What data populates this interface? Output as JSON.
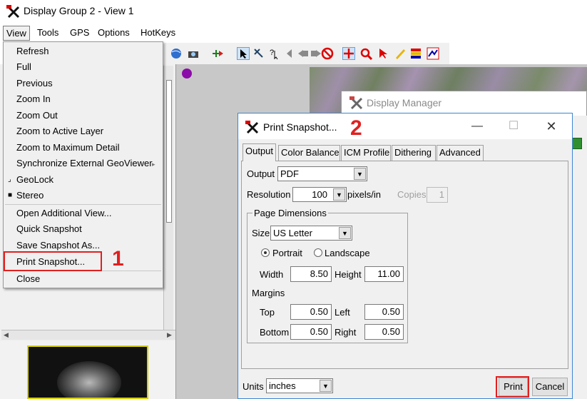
{
  "main_window": {
    "title": "Display Group 2 - View 1",
    "menu": [
      "View",
      "Tools",
      "GPS",
      "Options",
      "HotKeys"
    ]
  },
  "view_menu": {
    "items": [
      {
        "label": "Refresh"
      },
      {
        "label": "Full"
      },
      {
        "label": "Previous"
      },
      {
        "label": "Zoom In"
      },
      {
        "label": "Zoom Out"
      },
      {
        "label": "Zoom to Active Layer"
      },
      {
        "label": "Zoom to Maximum Detail"
      },
      {
        "label": "Synchronize External GeoViewer",
        "submenu": true
      },
      {
        "label": "GeoLock",
        "check": "unchecked"
      },
      {
        "label": "Stereo",
        "check": "checked"
      },
      {
        "label": "Open Additional View..."
      },
      {
        "label": "Quick Snapshot"
      },
      {
        "label": "Save Snapshot As..."
      },
      {
        "label": "Print Snapshot..."
      },
      {
        "label": "Close"
      }
    ]
  },
  "annotations": {
    "step1": "1",
    "step2": "2",
    "highlight_color": "#e02020"
  },
  "display_manager": {
    "title": "Display Manager"
  },
  "print_dialog": {
    "title": "Print Snapshot...",
    "tabs": [
      "Output",
      "Color Balance",
      "ICM Profile",
      "Dithering",
      "Advanced"
    ],
    "output_label": "Output",
    "output_value": "PDF",
    "resolution_label": "Resolution",
    "resolution_value": "100",
    "resolution_units": "pixels/in",
    "copies_label": "Copies",
    "copies_value": "1",
    "page_dimensions": {
      "title": "Page Dimensions",
      "size_label": "Size",
      "size_value": "US Letter",
      "orientation_portrait": "Portrait",
      "orientation_landscape": "Landscape",
      "selected_orientation": "Portrait",
      "width_label": "Width",
      "width_value": "8.50",
      "height_label": "Height",
      "height_value": "11.00",
      "margins_label": "Margins",
      "top_label": "Top",
      "top_value": "0.50",
      "left_label": "Left",
      "left_value": "0.50",
      "bottom_label": "Bottom",
      "bottom_value": "0.50",
      "right_label": "Right",
      "right_value": "0.50"
    },
    "units_label": "Units",
    "units_value": "inches",
    "print_button": "Print",
    "cancel_button": "Cancel"
  }
}
